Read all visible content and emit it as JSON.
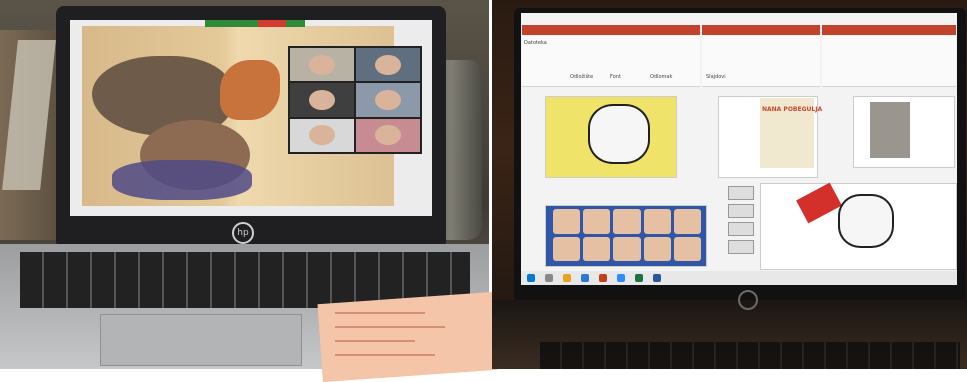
{
  "scene": {
    "left_photo": {
      "screen": {
        "app": "zoom",
        "book_illustration": "sleeping-animals-book-spread",
        "video_tiles": 6
      }
    },
    "right_photo": {
      "screen": {
        "app": "powerpoint",
        "window_titles": [
          "",
          "",
          ""
        ],
        "book_cover_title": "NANA POBEGULJA",
        "ribbon_labels": {
          "home_tab": "Datoteka",
          "slides_label": "Slajdovi",
          "clipboard_label": "Odložište",
          "font_label": "Font",
          "paragraph_label": "Odlomak"
        }
      }
    },
    "colors": {
      "ppt_red": "#c2432c",
      "zoom_green": "#2f8a3a",
      "zoom_red": "#d23b2f"
    }
  }
}
